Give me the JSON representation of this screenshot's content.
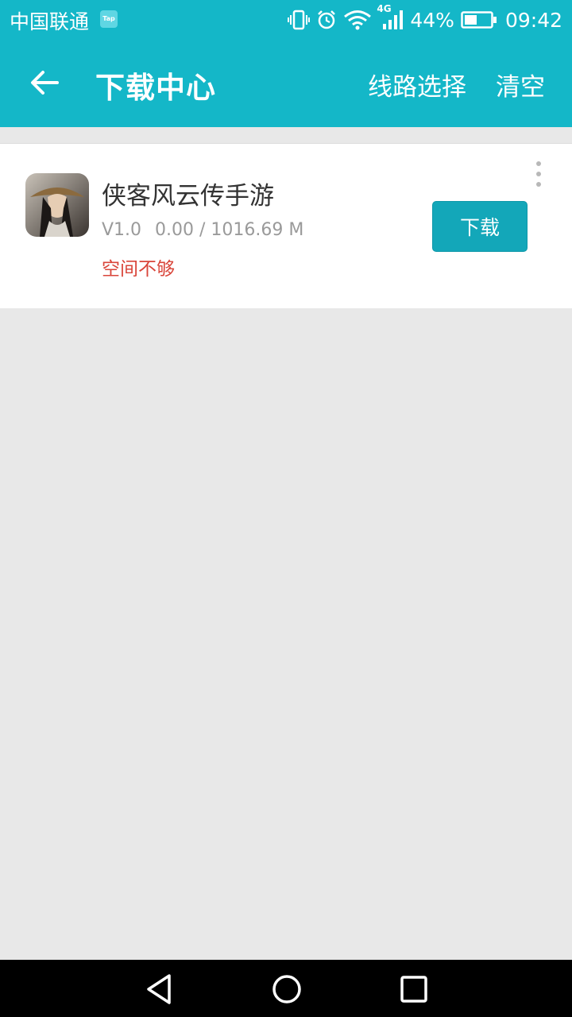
{
  "status_bar": {
    "carrier": "中国联通",
    "tap_badge": "Tap",
    "network": "4G",
    "battery": "44%",
    "time": "09:42"
  },
  "app_bar": {
    "title": "下载中心",
    "route_label": "线路选择",
    "clear_label": "清空"
  },
  "downloads": [
    {
      "name": "侠客风云传手游",
      "version": "V1.0",
      "progress": "0.00 / 1016.69 M",
      "status": "空间不够",
      "action_label": "下载"
    }
  ],
  "colors": {
    "accent": "#14b7c8",
    "button": "#13a7b9",
    "error": "#d9453a",
    "background": "#e8e8e8"
  }
}
